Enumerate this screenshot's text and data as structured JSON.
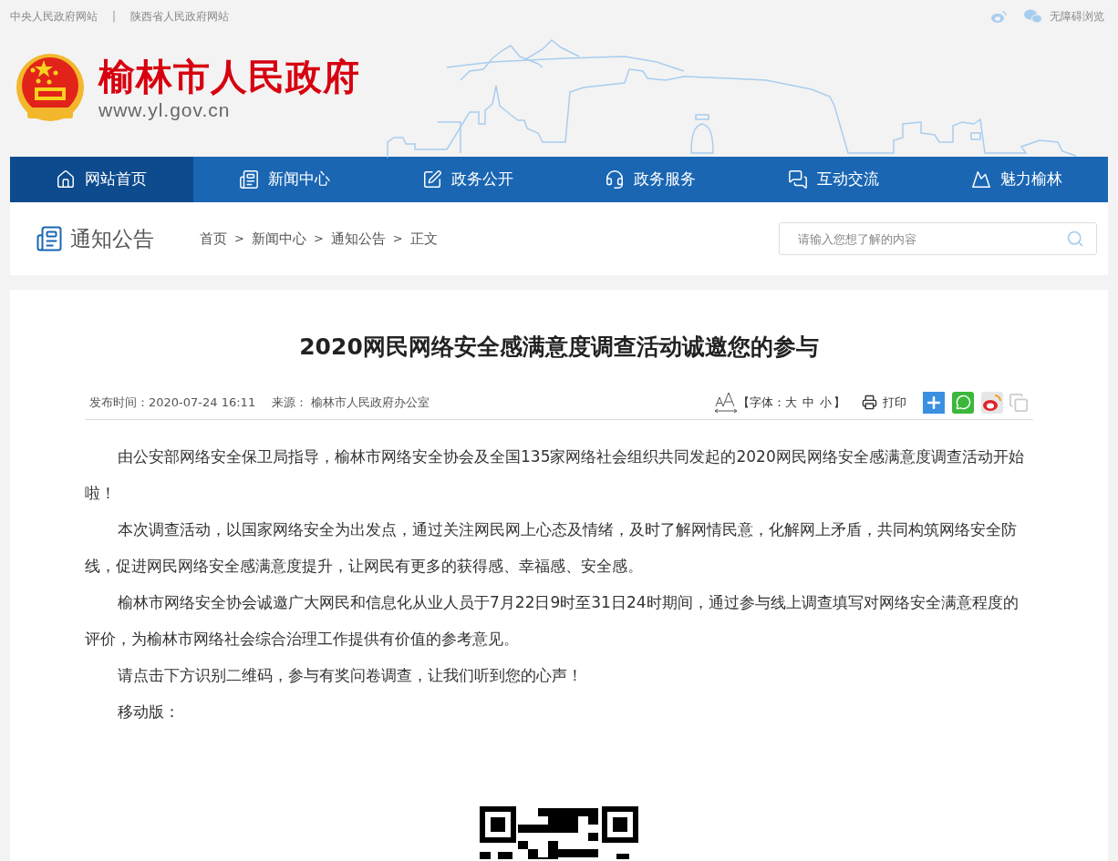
{
  "top_links": [
    {
      "label": "中央人民政府网站"
    },
    {
      "label": "陕西省人民政府网站"
    }
  ],
  "top_separator": "|",
  "top_right": {
    "accessibility": "无障碍浏览"
  },
  "site": {
    "title": "榆林市人民政府",
    "url": "www.yl.gov.cn"
  },
  "nav": [
    {
      "label": "网站首页",
      "selected": true
    },
    {
      "label": "新闻中心",
      "selected": false
    },
    {
      "label": "政务公开",
      "selected": false
    },
    {
      "label": "政务服务",
      "selected": false
    },
    {
      "label": "互动交流",
      "selected": false
    },
    {
      "label": "魅力榆林",
      "selected": false
    }
  ],
  "section_title": "通知公告",
  "breadcrumb": [
    "首页",
    "新闻中心",
    "通知公告",
    "正文"
  ],
  "breadcrumb_separator": ">",
  "search": {
    "placeholder": "请输入您想了解的内容"
  },
  "article": {
    "title": "2020网民网络安全感满意度调查活动诚邀您的参与",
    "published": "发布时间：2020-07-24 16:11",
    "source_label": "来源：",
    "source": "榆林市人民政府办公室",
    "font_open": "【字体：",
    "font_sizes": [
      "大",
      "中",
      "小"
    ],
    "font_close": "】",
    "print": "打印",
    "paragraphs": [
      "由公安部网络安全保卫局指导，榆林市网络安全协会及全国135家网络社会组织共同发起的2020网民网络安全感满意度调查活动开始啦！",
      "本次调查活动，以国家网络安全为出发点，通过关注网民网上心态及情绪，及时了解网情民意，化解网上矛盾，共同构筑网络安全防线，促进网民网络安全感满意度提升，让网民有更多的获得感、幸福感、安全感。",
      "榆林市网络安全协会诚邀广大网民和信息化从业人员于7月22日9时至31日24时期间，通过参与线上调查填写对网络安全满意程度的评价，为榆林市网络社会综合治理工作提供有价值的参考意见。",
      "请点击下方识别二维码，参与有奖问卷调查，让我们听到您的心声！",
      "移动版："
    ]
  }
}
